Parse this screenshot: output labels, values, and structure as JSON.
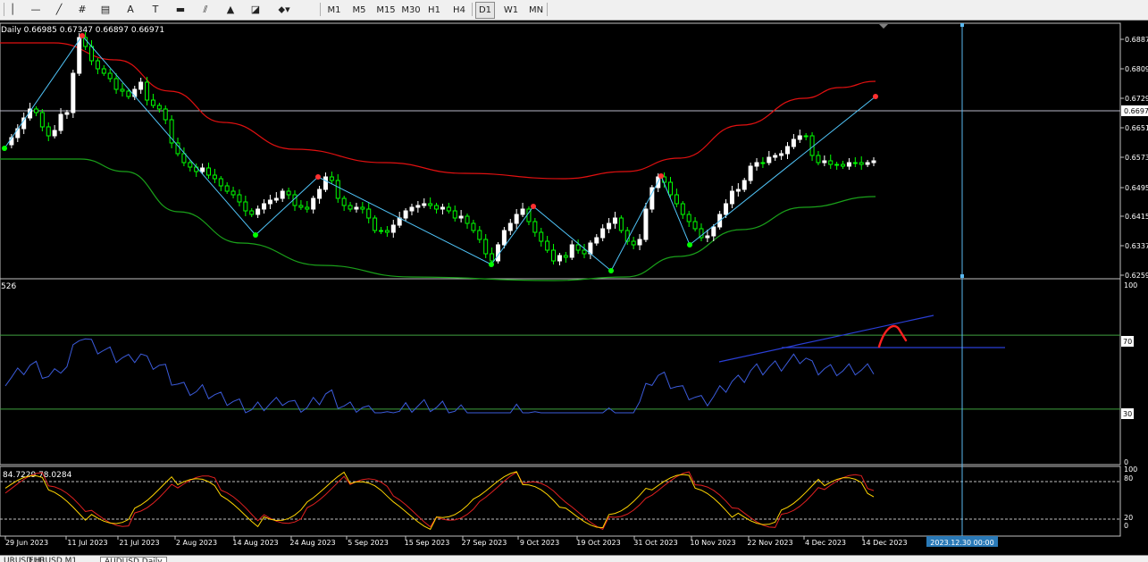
{
  "toolbar": {
    "tools": [
      {
        "name": "crosshair-tool",
        "glyph": "│"
      },
      {
        "name": "horizontal-line-tool",
        "glyph": "—"
      },
      {
        "name": "trendline-tool",
        "glyph": "╱"
      },
      {
        "name": "fibonacci-tool",
        "glyph": "#"
      },
      {
        "name": "period-separator-tool",
        "glyph": "▤"
      },
      {
        "name": "text-tool",
        "glyph": "A"
      },
      {
        "name": "text-label-tool",
        "glyph": "T"
      },
      {
        "name": "rectangle-tool",
        "glyph": "▬"
      },
      {
        "name": "channel-tool",
        "glyph": "⫽"
      },
      {
        "name": "triangle-tool",
        "glyph": "▲"
      },
      {
        "name": "arrow-tool",
        "glyph": "◪"
      },
      {
        "name": "shapes-menu-tool",
        "glyph": "⬥▾"
      }
    ],
    "timeframes": [
      "M1",
      "M5",
      "M15",
      "M30",
      "H1",
      "H4",
      "D1",
      "W1",
      "MN"
    ],
    "active_timeframe": "D1"
  },
  "main_chart": {
    "info": "Daily  0.66985 0.67347 0.66897 0.66971",
    "price_labels": [
      "0.6887",
      "0.6809",
      "0.6729",
      "0.6651",
      "0.6573",
      "0.6495",
      "0.6415",
      "0.6337",
      "0.6259"
    ],
    "current_price": "0.6697"
  },
  "rsi": {
    "info": "526",
    "levels": [
      "100",
      "70",
      "30",
      "0"
    ]
  },
  "stoch": {
    "info": "84.7229 78.0284",
    "levels": [
      "100",
      "80",
      "20",
      "0"
    ]
  },
  "date_labels": [
    "29 Jun 2023",
    "11 Jul 2023",
    "21 Jul 2023",
    "2 Aug 2023",
    "14 Aug 2023",
    "24 Aug 2023",
    "5 Sep 2023",
    "15 Sep 2023",
    "27 Sep 2023",
    "9 Oct 2023",
    "19 Oct 2023",
    "31 Oct 2023",
    "10 Nov 2023",
    "22 Nov 2023",
    "4 Dec 2023",
    "14 Dec 2023"
  ],
  "crosshair_date": "2023.12.30 00:00",
  "tabs": [
    "URUSD,H1",
    "EURUSD,M1",
    "AUDUSD,Daily"
  ],
  "colors": {
    "bull": "#ffffff",
    "bear": "#00ff00",
    "upper_band": "#e01010",
    "lower_band": "#1aa01a",
    "zigzag": "#4fc3f7",
    "rsi": "#3b5bdb",
    "stoch_main": "#ffd400",
    "stoch_signal": "#e02020",
    "grid": "#c0c0c0"
  },
  "chart_data": {
    "type": "candlestick",
    "symbol_timeframe": "Daily",
    "last_ohlc": {
      "open": 0.66985,
      "high": 0.67347,
      "low": 0.66897,
      "close": 0.66971
    },
    "ylim": [
      0.6259,
      0.6887
    ]
  }
}
